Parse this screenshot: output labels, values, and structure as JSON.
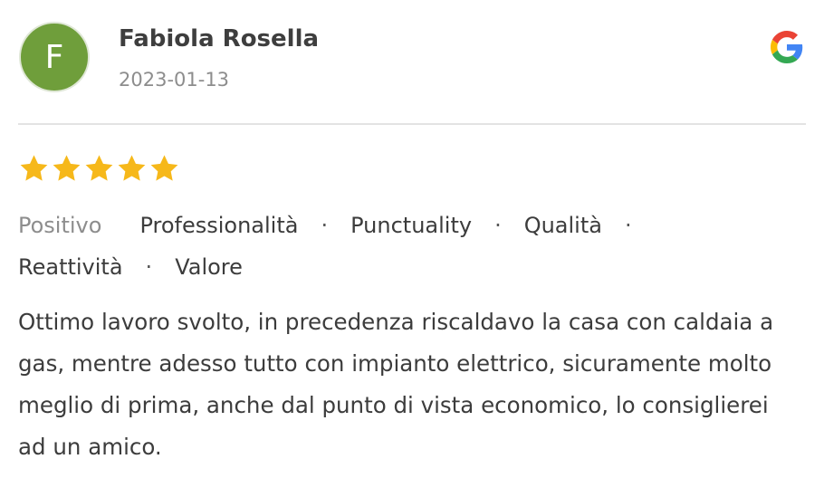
{
  "review": {
    "avatar_letter": "F",
    "author": "Fabiola Rosella",
    "date": "2023-01-13",
    "source_icon": "google-g-icon",
    "rating": 5,
    "rating_max": 5,
    "tags_lead": "Positivo",
    "tags": [
      "Professionalità",
      "Punctuality",
      "Qualità",
      "Reattività",
      "Valore"
    ],
    "text": "Ottimo lavoro svolto, in precedenza riscaldavo la casa con caldaia a gas, mentre adesso tutto con impianto elettrico, sicuramente molto meglio di prima, anche dal punto di vista economico, lo consiglierei ad un amico."
  },
  "colors": {
    "avatar": "#6f9e3b",
    "star": "#f6b81a",
    "muted_text": "#8d8d8d",
    "divider": "#e3e3e3"
  }
}
